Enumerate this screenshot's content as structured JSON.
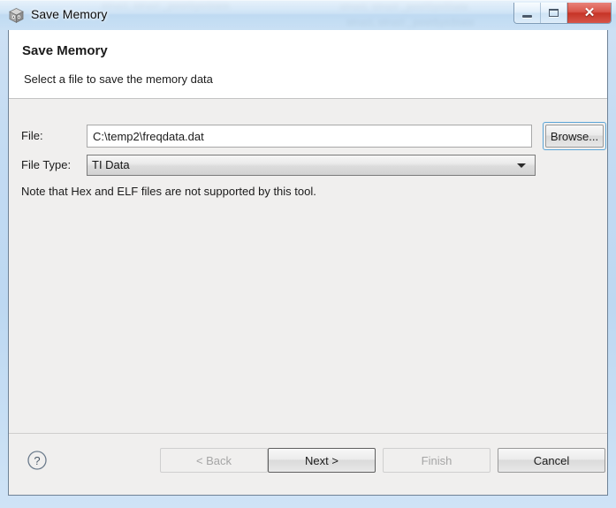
{
  "window": {
    "title": "Save Memory",
    "icon": "cube-icon",
    "controls": {
      "minimize_label": "Minimize",
      "maximize_label": "Maximize",
      "close_label": "Close",
      "close_glyph": "✕"
    }
  },
  "header": {
    "title": "Save Memory",
    "description": "Select a file to save the memory data"
  },
  "form": {
    "file_label": "File:",
    "file_value": "C:\\temp2\\freqdata.dat",
    "file_placeholder": "",
    "browse_label": "Browse...",
    "filetype_label": "File Type:",
    "filetype_value": "TI Data",
    "note": "Note that Hex and ELF files are not supported by this tool."
  },
  "buttons": {
    "help": "?",
    "back": "< Back",
    "next": "Next >",
    "finish": "Finish",
    "cancel": "Cancel"
  },
  "backdrop": {
    "blurred_lines": [
      "struct, struct _postSysState",
      "struct, struct _postSysState",
      "struct, struct _postSysState"
    ]
  },
  "colors": {
    "titlebar_glass": "#cfe1f4",
    "close_button": "#c63427",
    "dialog_bg": "#f0efee",
    "header_bg": "#ffffff",
    "focus_ring": "#5ba4d6",
    "border": "#6f8296"
  }
}
